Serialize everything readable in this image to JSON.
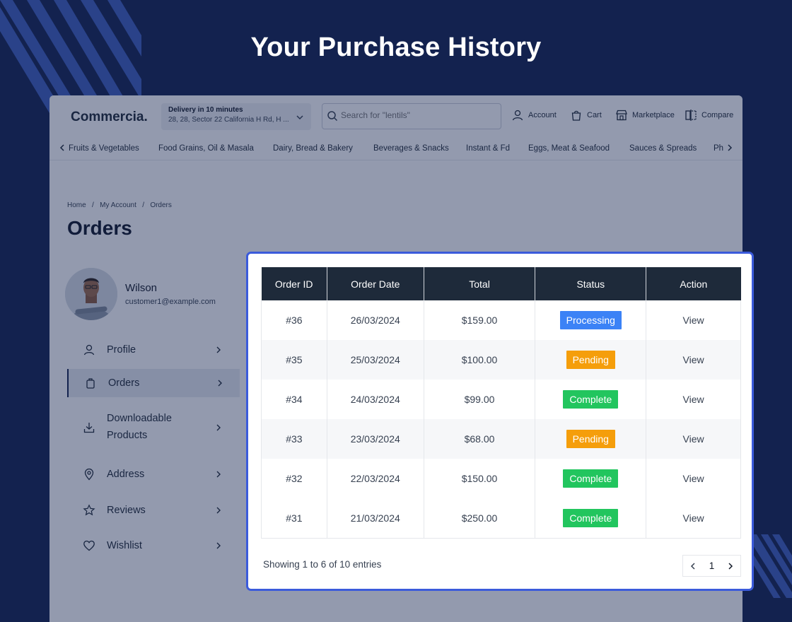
{
  "hero": {
    "title": "Your Purchase History"
  },
  "header": {
    "logo": "Commercia.",
    "delivery_title": "Delivery in 10 minutes",
    "delivery_address": "28, 28, Sector 22 California H Rd, H ...",
    "search_placeholder": "Search for \"lentils\"",
    "nav": {
      "account": "Account",
      "cart": "Cart",
      "marketplace": "Marketplace",
      "compare": "Compare"
    }
  },
  "categories": [
    "Fruits & Vegetables",
    "Food Grains, Oil & Masala",
    "Dairy, Bread & Bakery",
    "Beverages & Snacks",
    "Instant & Fd",
    "Eggs, Meat & Seafood",
    "Sauces & Spreads",
    "Ph"
  ],
  "breadcrumb": {
    "home": "Home",
    "sep": "/",
    "account": "My Account",
    "current": "Orders"
  },
  "page": {
    "title": "Orders"
  },
  "user": {
    "name": "Wilson",
    "email": "customer1@example.com"
  },
  "menu": [
    {
      "label": "Profile"
    },
    {
      "label": "Orders"
    },
    {
      "label": "Downloadable",
      "label2": "Products"
    },
    {
      "label": "Address"
    },
    {
      "label": "Reviews"
    },
    {
      "label": "Wishlist"
    }
  ],
  "orders_table": {
    "headers": [
      "Order ID",
      "Order Date",
      "Total",
      "Status",
      "Action"
    ],
    "rows": [
      {
        "id": "#36",
        "date": "26/03/2024",
        "total": "$159.00",
        "status": "Processing",
        "action": "View"
      },
      {
        "id": "#35",
        "date": "25/03/2024",
        "total": "$100.00",
        "status": "Pending",
        "action": "View"
      },
      {
        "id": "#34",
        "date": "24/03/2024",
        "total": "$99.00",
        "status": "Complete",
        "action": "View"
      },
      {
        "id": "#33",
        "date": "23/03/2024",
        "total": "$68.00",
        "status": "Pending",
        "action": "View"
      },
      {
        "id": "#32",
        "date": "22/03/2024",
        "total": "$150.00",
        "status": "Complete",
        "action": "View"
      },
      {
        "id": "#31",
        "date": "21/03/2024",
        "total": "$250.00",
        "status": "Complete",
        "action": "View"
      }
    ],
    "showing": "Showing 1 to 6 of 10 entries",
    "current_page": "1"
  },
  "colors": {
    "background": "#13224f",
    "highlight_border": "#3b5bdb",
    "table_header": "#1e2a3a",
    "processing": "#3b82f6",
    "pending": "#f59e0b",
    "complete": "#22c55e"
  },
  "icons": {
    "account": "user-icon",
    "cart": "bag-icon",
    "marketplace": "store-icon",
    "compare": "compare-icon",
    "search": "search-icon",
    "menu": [
      "user-icon",
      "bag-icon",
      "download-icon",
      "map-pin-icon",
      "star-icon",
      "heart-icon"
    ]
  }
}
